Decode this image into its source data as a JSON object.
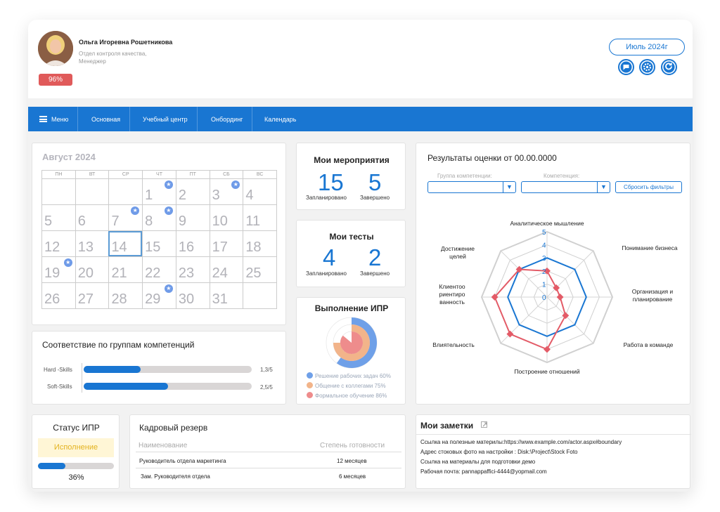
{
  "user": {
    "name": "Ольга Игоревна Рошетникова",
    "department": "Отдел контроля качества,",
    "position": "Менеджер",
    "progress_label": "96%"
  },
  "header": {
    "month_label": "Июль 2024г",
    "icons": [
      "chat-icon",
      "gear-icon",
      "refresh-icon"
    ]
  },
  "nav": {
    "menu_label": "Меню",
    "items": [
      "Основная",
      "Учебный центр",
      "Онбординг",
      "Календарь"
    ]
  },
  "calendar": {
    "title": "Август 2024",
    "weekdays": [
      "ПН",
      "ВТ",
      "СР",
      "ЧТ",
      "ПТ",
      "СБ",
      "ВС"
    ],
    "weeks": [
      [
        "",
        "",
        "",
        "1",
        "2",
        "3",
        "4"
      ],
      [
        "5",
        "6",
        "7",
        "8",
        "9",
        "10",
        "11"
      ],
      [
        "12",
        "13",
        "14",
        "15",
        "16",
        "17",
        "18"
      ],
      [
        "19",
        "20",
        "21",
        "22",
        "23",
        "24",
        "25"
      ],
      [
        "26",
        "27",
        "28",
        "29",
        "30",
        "31",
        ""
      ]
    ],
    "today": "14",
    "event_days": [
      "1",
      "3",
      "7",
      "8",
      "19",
      "29"
    ]
  },
  "events": {
    "title": "Мои мероприятия",
    "planned_value": "15",
    "planned_label": "Запланировано",
    "done_value": "5",
    "done_label": "Завершено"
  },
  "tests": {
    "title": "Мои тесты",
    "planned_value": "4",
    "planned_label": "Запланировано",
    "done_value": "2",
    "done_label": "Завершено"
  },
  "ipr_progress": {
    "title": "Выполнение  ИПР",
    "legend": [
      {
        "label": "Решение рабочих задач 60%",
        "color": "#6fa0e8",
        "value": 60
      },
      {
        "label": "Общение с коллегами 75%",
        "color": "#f2b48a",
        "value": 75
      },
      {
        "label": "Формальное обучение 86%",
        "color": "#ee8c8c",
        "value": 86
      }
    ]
  },
  "competence": {
    "title": "Соответствие по группам компетенций",
    "rows": [
      {
        "label": "Hard -Skills",
        "value_label": "1,3/5",
        "fraction": 0.34
      },
      {
        "label": "Soft-Skills",
        "value_label": "2,5/5",
        "fraction": 0.5
      }
    ]
  },
  "assessment": {
    "title": "Результаты оценки от 00.00.0000",
    "group_label": "Группа компетенции:",
    "competence_label": "Компетенция:",
    "reset_label": "Сбросить фильтры",
    "ticks": [
      "0",
      "1",
      "2",
      "3",
      "4",
      "5"
    ],
    "axes": [
      "Аналитическое мышление",
      "Понимание бизнеса",
      "Организация и планирование",
      "Работа в команде",
      "Построение отношений",
      "Влиятельность",
      "Клиентоориентированность",
      "Достижение целей"
    ],
    "axis_labels_display": [
      "Аналитическое мышление",
      "Понимание бизнеса",
      "Организация и\nпланирование",
      "Работа в команде",
      "Построение отношений",
      "Влиятельность",
      "Клиентоо\nриентиро\nванность",
      "Достижение\nцелей"
    ],
    "series_blue": [
      3,
      3,
      3,
      3,
      3,
      3,
      3,
      3
    ],
    "series_red": [
      2,
      1,
      1,
      2,
      4,
      4,
      4,
      3
    ],
    "colors": {
      "blue": "#1976d2",
      "red": "#e35b67"
    }
  },
  "ipr_status": {
    "title": "Статус ИПР",
    "status": "Исполнение",
    "percent_label": "36%",
    "fraction": 0.36
  },
  "reserve": {
    "title": "Кадровый резерв",
    "col_name": "Наименование",
    "col_ready": "Степень готовности",
    "rows": [
      {
        "name": "Руководитель отдела маркетинга",
        "ready": "12 месяцев"
      },
      {
        "name": "Зам. Руководителя отдела",
        "ready": "6 месяцев"
      }
    ]
  },
  "notes": {
    "title": "Мои заметки",
    "lines": [
      "Ссылка на полезные материлы:https://www.example.com/actor.aspx#boundary",
      "Адрес стоковых фото на настройки : Disk:\\Project\\Stock Foto",
      "Ссылка на материалы для подготовки демо",
      "Рабочая почта: pannappaffici-4444@yopmail.com"
    ]
  }
}
